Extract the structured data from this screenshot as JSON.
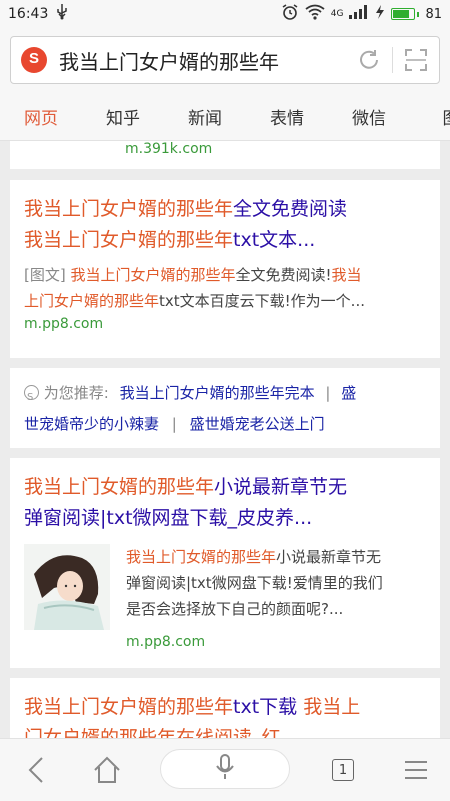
{
  "status_bar": {
    "time": "16:43",
    "signal_4g": "4G",
    "battery": "81",
    "battery_level": 0.81
  },
  "search": {
    "query": "我当上门女户婿的那些年"
  },
  "tabs": [
    {
      "label": "网页",
      "active": true
    },
    {
      "label": "知乎"
    },
    {
      "label": "新闻"
    },
    {
      "label": "表情"
    },
    {
      "label": "微信"
    },
    {
      "label": "图"
    }
  ],
  "results": {
    "r0": {
      "url": "m.391k.com"
    },
    "r1": {
      "title_hl": "我当上门女户婿的那些年",
      "title_rest": "全文免费阅读",
      "title_line2_hl": "我当上门女户婿的那些年",
      "title_line2_rest": "txt文本...",
      "tag": "[图文]",
      "snip_hl1": "我当上门女户婿的那些年",
      "snip_mid": "全文免费阅读!",
      "snip_hl2a": "我当",
      "snip_hl2b": "上门女户婿的那些年",
      "snip_rest": "txt文本百度云下载!作为一个...",
      "url": "m.pp8.com"
    },
    "recommend": {
      "label": "为您推荐:",
      "links": [
        "我当上门女户婿的那些年完本",
        "盛世宠婚帝少的小辣妻",
        "盛世婚宠老公送上门"
      ],
      "link2_prefix": "盛",
      "link2_rest": "世宠婚帝少的小辣妻"
    },
    "r2": {
      "title_hl": "我当上门女婿的那些年",
      "title_rest": "小说最新章节无",
      "title_line2": "弹窗阅读|txt微网盘下载_皮皮养...",
      "snip_hl": "我当上门女婿的那些年",
      "snip_rest": "小说最新章节无",
      "snip_line2": "弹窗阅读|txt微网盘下载!爱情里的我们",
      "snip_line3": "是否会选择放下自己的颜面呢?...",
      "url": "m.pp8.com"
    },
    "r3": {
      "title_hl1": "我当上门女户婿的那些年",
      "title_mid": "txt下载",
      "title_hl2": "我当上",
      "title_line2": "门女户婿的那些年在线阅读_红..."
    }
  },
  "bottom_bar": {
    "tab_count": "1"
  },
  "colors": {
    "highlight": "#e05a2a",
    "title": "#2b0fa6",
    "url": "#3a9a3a",
    "active_tab": "#e05c3a"
  }
}
